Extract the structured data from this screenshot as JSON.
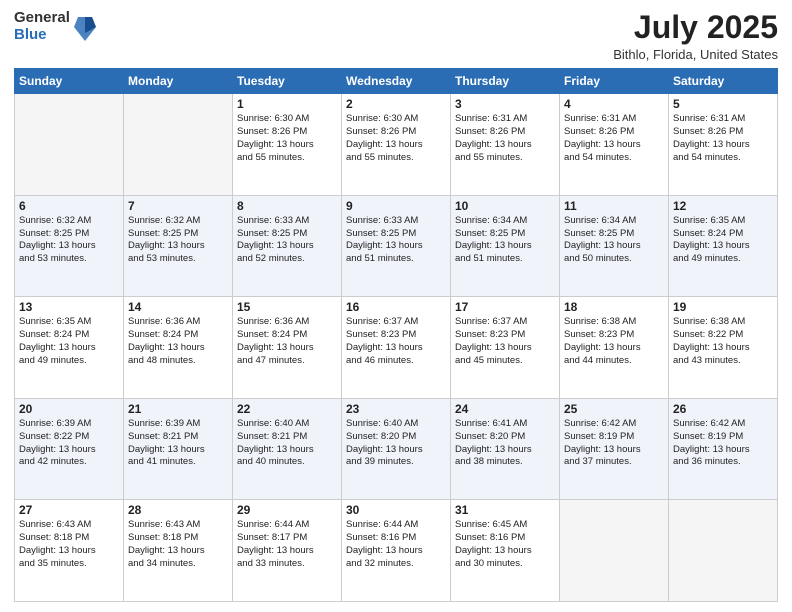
{
  "header": {
    "logo_general": "General",
    "logo_blue": "Blue",
    "month_title": "July 2025",
    "location": "Bithlo, Florida, United States"
  },
  "weekdays": [
    "Sunday",
    "Monday",
    "Tuesday",
    "Wednesday",
    "Thursday",
    "Friday",
    "Saturday"
  ],
  "weeks": [
    [
      {
        "day": "",
        "info": ""
      },
      {
        "day": "",
        "info": ""
      },
      {
        "day": "1",
        "info": "Sunrise: 6:30 AM\nSunset: 8:26 PM\nDaylight: 13 hours\nand 55 minutes."
      },
      {
        "day": "2",
        "info": "Sunrise: 6:30 AM\nSunset: 8:26 PM\nDaylight: 13 hours\nand 55 minutes."
      },
      {
        "day": "3",
        "info": "Sunrise: 6:31 AM\nSunset: 8:26 PM\nDaylight: 13 hours\nand 55 minutes."
      },
      {
        "day": "4",
        "info": "Sunrise: 6:31 AM\nSunset: 8:26 PM\nDaylight: 13 hours\nand 54 minutes."
      },
      {
        "day": "5",
        "info": "Sunrise: 6:31 AM\nSunset: 8:26 PM\nDaylight: 13 hours\nand 54 minutes."
      }
    ],
    [
      {
        "day": "6",
        "info": "Sunrise: 6:32 AM\nSunset: 8:25 PM\nDaylight: 13 hours\nand 53 minutes."
      },
      {
        "day": "7",
        "info": "Sunrise: 6:32 AM\nSunset: 8:25 PM\nDaylight: 13 hours\nand 53 minutes."
      },
      {
        "day": "8",
        "info": "Sunrise: 6:33 AM\nSunset: 8:25 PM\nDaylight: 13 hours\nand 52 minutes."
      },
      {
        "day": "9",
        "info": "Sunrise: 6:33 AM\nSunset: 8:25 PM\nDaylight: 13 hours\nand 51 minutes."
      },
      {
        "day": "10",
        "info": "Sunrise: 6:34 AM\nSunset: 8:25 PM\nDaylight: 13 hours\nand 51 minutes."
      },
      {
        "day": "11",
        "info": "Sunrise: 6:34 AM\nSunset: 8:25 PM\nDaylight: 13 hours\nand 50 minutes."
      },
      {
        "day": "12",
        "info": "Sunrise: 6:35 AM\nSunset: 8:24 PM\nDaylight: 13 hours\nand 49 minutes."
      }
    ],
    [
      {
        "day": "13",
        "info": "Sunrise: 6:35 AM\nSunset: 8:24 PM\nDaylight: 13 hours\nand 49 minutes."
      },
      {
        "day": "14",
        "info": "Sunrise: 6:36 AM\nSunset: 8:24 PM\nDaylight: 13 hours\nand 48 minutes."
      },
      {
        "day": "15",
        "info": "Sunrise: 6:36 AM\nSunset: 8:24 PM\nDaylight: 13 hours\nand 47 minutes."
      },
      {
        "day": "16",
        "info": "Sunrise: 6:37 AM\nSunset: 8:23 PM\nDaylight: 13 hours\nand 46 minutes."
      },
      {
        "day": "17",
        "info": "Sunrise: 6:37 AM\nSunset: 8:23 PM\nDaylight: 13 hours\nand 45 minutes."
      },
      {
        "day": "18",
        "info": "Sunrise: 6:38 AM\nSunset: 8:23 PM\nDaylight: 13 hours\nand 44 minutes."
      },
      {
        "day": "19",
        "info": "Sunrise: 6:38 AM\nSunset: 8:22 PM\nDaylight: 13 hours\nand 43 minutes."
      }
    ],
    [
      {
        "day": "20",
        "info": "Sunrise: 6:39 AM\nSunset: 8:22 PM\nDaylight: 13 hours\nand 42 minutes."
      },
      {
        "day": "21",
        "info": "Sunrise: 6:39 AM\nSunset: 8:21 PM\nDaylight: 13 hours\nand 41 minutes."
      },
      {
        "day": "22",
        "info": "Sunrise: 6:40 AM\nSunset: 8:21 PM\nDaylight: 13 hours\nand 40 minutes."
      },
      {
        "day": "23",
        "info": "Sunrise: 6:40 AM\nSunset: 8:20 PM\nDaylight: 13 hours\nand 39 minutes."
      },
      {
        "day": "24",
        "info": "Sunrise: 6:41 AM\nSunset: 8:20 PM\nDaylight: 13 hours\nand 38 minutes."
      },
      {
        "day": "25",
        "info": "Sunrise: 6:42 AM\nSunset: 8:19 PM\nDaylight: 13 hours\nand 37 minutes."
      },
      {
        "day": "26",
        "info": "Sunrise: 6:42 AM\nSunset: 8:19 PM\nDaylight: 13 hours\nand 36 minutes."
      }
    ],
    [
      {
        "day": "27",
        "info": "Sunrise: 6:43 AM\nSunset: 8:18 PM\nDaylight: 13 hours\nand 35 minutes."
      },
      {
        "day": "28",
        "info": "Sunrise: 6:43 AM\nSunset: 8:18 PM\nDaylight: 13 hours\nand 34 minutes."
      },
      {
        "day": "29",
        "info": "Sunrise: 6:44 AM\nSunset: 8:17 PM\nDaylight: 13 hours\nand 33 minutes."
      },
      {
        "day": "30",
        "info": "Sunrise: 6:44 AM\nSunset: 8:16 PM\nDaylight: 13 hours\nand 32 minutes."
      },
      {
        "day": "31",
        "info": "Sunrise: 6:45 AM\nSunset: 8:16 PM\nDaylight: 13 hours\nand 30 minutes."
      },
      {
        "day": "",
        "info": ""
      },
      {
        "day": "",
        "info": ""
      }
    ]
  ]
}
